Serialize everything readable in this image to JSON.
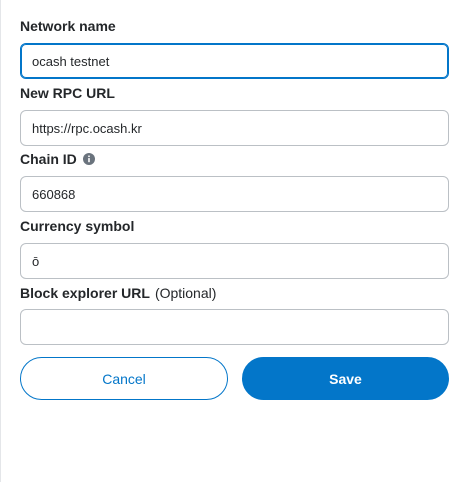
{
  "form": {
    "network_name": {
      "label": "Network name",
      "value": "ocash testnet"
    },
    "rpc_url": {
      "label": "New RPC URL",
      "value": "https://rpc.ocash.kr"
    },
    "chain_id": {
      "label": "Chain ID",
      "value": "660868",
      "icon": "info-icon"
    },
    "currency_symbol": {
      "label": "Currency symbol",
      "value": "ō"
    },
    "block_explorer": {
      "label": "Block explorer URL",
      "optional": "(Optional)",
      "value": ""
    }
  },
  "actions": {
    "cancel_label": "Cancel",
    "save_label": "Save"
  },
  "colors": {
    "accent": "#0376c9",
    "border": "#bbc0c5",
    "text": "#24272a"
  }
}
